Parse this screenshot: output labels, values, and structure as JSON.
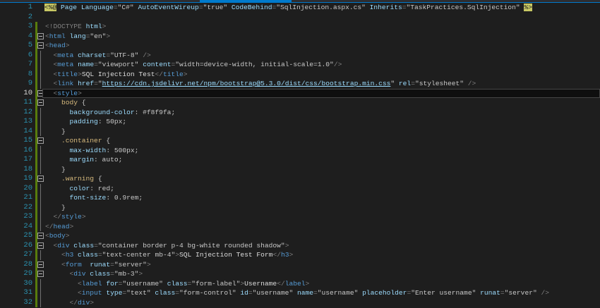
{
  "editor": {
    "current_line": 10,
    "lines": [
      {
        "n": "1",
        "indent": 0,
        "tokens": [
          [
            "h",
            "<%@"
          ],
          [
            "a",
            " Page "
          ],
          [
            "a",
            "Language"
          ],
          [
            "d",
            "="
          ],
          [
            "v",
            "\"C#\" "
          ],
          [
            "a",
            "AutoEventWireup"
          ],
          [
            "d",
            "="
          ],
          [
            "v",
            "\"true\" "
          ],
          [
            "a",
            "CodeBehind"
          ],
          [
            "d",
            "="
          ],
          [
            "v",
            "\"SqlInjection.aspx.cs\" "
          ],
          [
            "a",
            "Inherits"
          ],
          [
            "d",
            "="
          ],
          [
            "v",
            "\"TaskPractices.SqlInjection\" "
          ],
          [
            "h",
            "%>"
          ]
        ]
      },
      {
        "n": "2",
        "indent": 0,
        "tokens": []
      },
      {
        "n": "3",
        "indent": 0,
        "tokens": [
          [
            "d",
            "<!"
          ],
          [
            "d",
            "DOCTYPE "
          ],
          [
            "a",
            "html"
          ],
          [
            "d",
            ">"
          ]
        ]
      },
      {
        "n": "4",
        "indent": 0,
        "fold": true,
        "tokens": [
          [
            "d",
            "<"
          ],
          [
            "t",
            "html "
          ],
          [
            "a",
            "lang"
          ],
          [
            "d",
            "="
          ],
          [
            "v",
            "\"en\""
          ],
          [
            "d",
            ">"
          ]
        ]
      },
      {
        "n": "5",
        "indent": 0,
        "fold": true,
        "tokens": [
          [
            "d",
            "<"
          ],
          [
            "t",
            "head"
          ],
          [
            "d",
            ">"
          ]
        ]
      },
      {
        "n": "6",
        "indent": 1,
        "tokens": [
          [
            "d",
            "<"
          ],
          [
            "t",
            "meta "
          ],
          [
            "a",
            "charset"
          ],
          [
            "d",
            "="
          ],
          [
            "v",
            "\"UTF-8\" "
          ],
          [
            "d",
            "/>"
          ]
        ]
      },
      {
        "n": "7",
        "indent": 1,
        "tokens": [
          [
            "d",
            "<"
          ],
          [
            "t",
            "meta "
          ],
          [
            "a",
            "name"
          ],
          [
            "d",
            "="
          ],
          [
            "v",
            "\"viewport\" "
          ],
          [
            "a",
            "content"
          ],
          [
            "d",
            "="
          ],
          [
            "v",
            "\"width=device-width, initial-scale=1.0\""
          ],
          [
            "d",
            "/>"
          ]
        ]
      },
      {
        "n": "8",
        "indent": 1,
        "tokens": [
          [
            "d",
            "<"
          ],
          [
            "t",
            "title"
          ],
          [
            "d",
            ">"
          ],
          [
            "x",
            "SQL Injection Test"
          ],
          [
            "d",
            "</"
          ],
          [
            "t",
            "title"
          ],
          [
            "d",
            ">"
          ]
        ]
      },
      {
        "n": "9",
        "indent": 1,
        "tokens": [
          [
            "d",
            "<"
          ],
          [
            "t",
            "link "
          ],
          [
            "a",
            "href"
          ],
          [
            "d",
            "="
          ],
          [
            "v",
            "\""
          ],
          [
            "u",
            "https://cdn.jsdelivr.net/npm/bootstrap@5.3.0/dist/css/bootstrap.min.css"
          ],
          [
            "v",
            "\" "
          ],
          [
            "a",
            "rel"
          ],
          [
            "d",
            "="
          ],
          [
            "v",
            "\"stylesheet\" "
          ],
          [
            "d",
            "/>"
          ]
        ]
      },
      {
        "n": "10",
        "indent": 1,
        "fold": true,
        "tokens": [
          [
            "d",
            "<"
          ],
          [
            "t",
            "style"
          ],
          [
            "d",
            ">"
          ]
        ]
      },
      {
        "n": "11",
        "indent": 2,
        "fold": true,
        "tokens": [
          [
            "s",
            "body "
          ],
          [
            "v",
            "{"
          ]
        ]
      },
      {
        "n": "12",
        "indent": 3,
        "tokens": [
          [
            "p",
            "background-color"
          ],
          [
            "v",
            ": #f8f9fa;"
          ]
        ]
      },
      {
        "n": "13",
        "indent": 3,
        "tokens": [
          [
            "p",
            "padding"
          ],
          [
            "v",
            ": 50px;"
          ]
        ]
      },
      {
        "n": "14",
        "indent": 2,
        "tokens": [
          [
            "v",
            "}"
          ]
        ]
      },
      {
        "n": "15",
        "indent": 2,
        "fold": true,
        "tokens": [
          [
            "s",
            ".container "
          ],
          [
            "v",
            "{"
          ]
        ]
      },
      {
        "n": "16",
        "indent": 3,
        "tokens": [
          [
            "p",
            "max-width"
          ],
          [
            "v",
            ": 500px;"
          ]
        ]
      },
      {
        "n": "17",
        "indent": 3,
        "tokens": [
          [
            "p",
            "margin"
          ],
          [
            "v",
            ": auto;"
          ]
        ]
      },
      {
        "n": "18",
        "indent": 2,
        "tokens": [
          [
            "v",
            "}"
          ]
        ]
      },
      {
        "n": "19",
        "indent": 2,
        "fold": true,
        "tokens": [
          [
            "s",
            ".warning "
          ],
          [
            "v",
            "{"
          ]
        ]
      },
      {
        "n": "20",
        "indent": 3,
        "tokens": [
          [
            "p",
            "color"
          ],
          [
            "v",
            ": red;"
          ]
        ]
      },
      {
        "n": "21",
        "indent": 3,
        "tokens": [
          [
            "p",
            "font-size"
          ],
          [
            "v",
            ": 0.9rem;"
          ]
        ]
      },
      {
        "n": "22",
        "indent": 2,
        "tokens": [
          [
            "v",
            "}"
          ]
        ]
      },
      {
        "n": "23",
        "indent": 1,
        "tokens": [
          [
            "d",
            "</"
          ],
          [
            "t",
            "style"
          ],
          [
            "d",
            ">"
          ]
        ]
      },
      {
        "n": "24",
        "indent": 0,
        "tokens": [
          [
            "d",
            "</"
          ],
          [
            "t",
            "head"
          ],
          [
            "d",
            ">"
          ]
        ]
      },
      {
        "n": "25",
        "indent": 0,
        "fold": true,
        "tokens": [
          [
            "d",
            "<"
          ],
          [
            "t",
            "body"
          ],
          [
            "d",
            ">"
          ]
        ]
      },
      {
        "n": "26",
        "indent": 1,
        "fold": true,
        "tokens": [
          [
            "d",
            "<"
          ],
          [
            "t",
            "div "
          ],
          [
            "a",
            "class"
          ],
          [
            "d",
            "="
          ],
          [
            "v",
            "\"container border p-4 bg-white rounded shadow\""
          ],
          [
            "d",
            ">"
          ]
        ]
      },
      {
        "n": "27",
        "indent": 2,
        "tokens": [
          [
            "d",
            "<"
          ],
          [
            "t",
            "h3 "
          ],
          [
            "a",
            "class"
          ],
          [
            "d",
            "="
          ],
          [
            "v",
            "\"text-center mb-4\""
          ],
          [
            "d",
            ">"
          ],
          [
            "x",
            "SQL Injection Test Form"
          ],
          [
            "d",
            "</"
          ],
          [
            "t",
            "h3"
          ],
          [
            "d",
            ">"
          ]
        ]
      },
      {
        "n": "28",
        "indent": 2,
        "fold": true,
        "tokens": [
          [
            "d",
            "<"
          ],
          [
            "t",
            "form  "
          ],
          [
            "a",
            "runat"
          ],
          [
            "d",
            "="
          ],
          [
            "v",
            "\"server\""
          ],
          [
            "d",
            ">"
          ]
        ]
      },
      {
        "n": "29",
        "indent": 3,
        "fold": true,
        "tokens": [
          [
            "d",
            "<"
          ],
          [
            "t",
            "div "
          ],
          [
            "a",
            "class"
          ],
          [
            "d",
            "="
          ],
          [
            "v",
            "\"mb-3\""
          ],
          [
            "d",
            ">"
          ]
        ]
      },
      {
        "n": "30",
        "indent": 4,
        "tokens": [
          [
            "d",
            "<"
          ],
          [
            "t",
            "label "
          ],
          [
            "a",
            "for"
          ],
          [
            "d",
            "="
          ],
          [
            "v",
            "\"username\" "
          ],
          [
            "a",
            "class"
          ],
          [
            "d",
            "="
          ],
          [
            "v",
            "\"form-label\""
          ],
          [
            "d",
            ">"
          ],
          [
            "x",
            "Username"
          ],
          [
            "d",
            "</"
          ],
          [
            "t",
            "label"
          ],
          [
            "d",
            ">"
          ]
        ]
      },
      {
        "n": "31",
        "indent": 4,
        "tokens": [
          [
            "d",
            "<"
          ],
          [
            "t",
            "input "
          ],
          [
            "a",
            "type"
          ],
          [
            "d",
            "="
          ],
          [
            "v",
            "\"text\" "
          ],
          [
            "a",
            "class"
          ],
          [
            "d",
            "="
          ],
          [
            "v",
            "\"form-control\" "
          ],
          [
            "a",
            "id"
          ],
          [
            "d",
            "="
          ],
          [
            "v",
            "\"username\" "
          ],
          [
            "a",
            "name"
          ],
          [
            "d",
            "="
          ],
          [
            "v",
            "\"username\" "
          ],
          [
            "a",
            "placeholder"
          ],
          [
            "d",
            "="
          ],
          [
            "v",
            "\"Enter username\" "
          ],
          [
            "a",
            "runat"
          ],
          [
            "d",
            "="
          ],
          [
            "v",
            "\"server\" "
          ],
          [
            "d",
            "/>"
          ]
        ]
      },
      {
        "n": "32",
        "indent": 3,
        "tokens": [
          [
            "d",
            "</"
          ],
          [
            "t",
            "div"
          ],
          [
            "d",
            ">"
          ]
        ]
      }
    ]
  }
}
